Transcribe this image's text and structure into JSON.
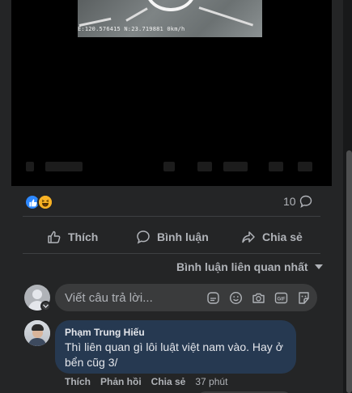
{
  "video": {
    "telemetry": "E:120.576415 N:23.719881  0km/h"
  },
  "post_stats": {
    "reactions": [
      "like-icon",
      "haha-icon"
    ],
    "comment_count": "10"
  },
  "actions": {
    "like_label": "Thích",
    "comment_label": "Bình luận",
    "share_label": "Chia sẻ"
  },
  "sort": {
    "label": "Bình luận liên quan nhất"
  },
  "reply_box": {
    "placeholder": "Viết câu trả lời...",
    "icons": [
      "sticker-icon",
      "emoji-icon",
      "camera-icon",
      "gif-icon",
      "avatar-sticker-icon"
    ]
  },
  "comment": {
    "author": "Phạm Trung Hiếu",
    "text": "Thì liên quan gì lôi luật việt nam vào. Hay ở bển cũg 3/",
    "like_label": "Thích",
    "reply_label": "Phản hồi",
    "share_label": "Chia sẻ",
    "time": "37 phút"
  },
  "colors": {
    "background": "#242526",
    "comment_bubble": "#263951",
    "input_bg": "#3a3b3c",
    "secondary_text": "#b0b3b8",
    "like_blue": "#2d88ff",
    "haha_yellow": "#f7b125"
  }
}
